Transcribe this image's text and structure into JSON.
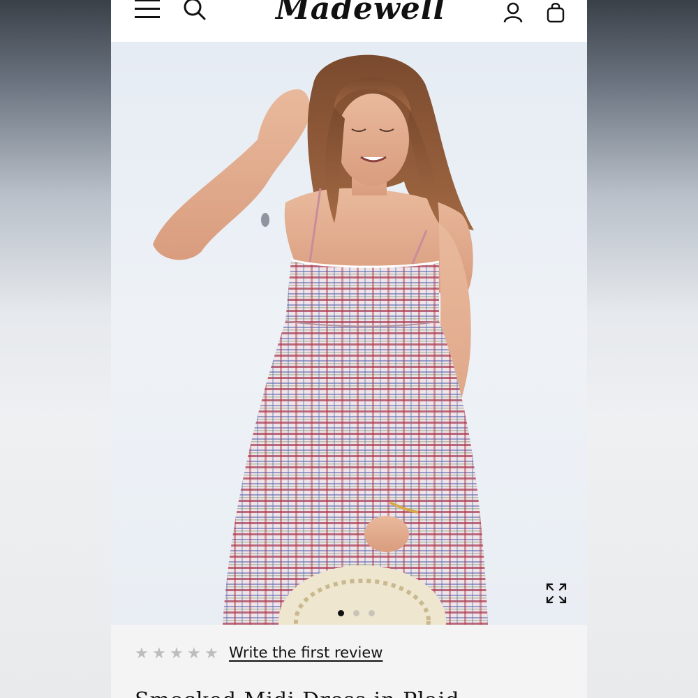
{
  "brand": {
    "logo_text": "Madewell"
  },
  "header": {
    "menu_icon": "hamburger-menu-icon",
    "search_icon": "search-icon",
    "account_icon": "account-icon",
    "bag_icon": "shopping-bag-icon"
  },
  "gallery": {
    "image_alt": "Model wearing a smocked plaid midi dress holding a straw hat",
    "expand_icon": "expand-fullscreen-icon",
    "slide_count": 3,
    "active_slide": 1
  },
  "reviews": {
    "rating": 0,
    "max_rating": 5,
    "link_label": "Write the first review"
  },
  "product": {
    "title_partial": "Smocked Midi Dress in Plaid"
  },
  "colors": {
    "header_bg": "#ffffff",
    "page_bg": "#f4f4f4",
    "star_empty": "#bdbdbd",
    "dot_active": "#111111",
    "dot_inactive": "#c9c3b8"
  }
}
